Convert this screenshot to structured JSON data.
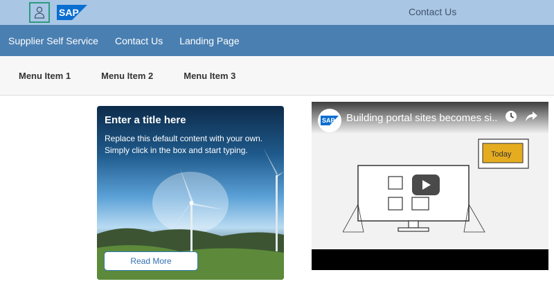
{
  "header": {
    "logo_text": "SAP",
    "contact_label": "Contact Us"
  },
  "nav": {
    "items": [
      {
        "label": "Supplier Self Service"
      },
      {
        "label": "Contact Us"
      },
      {
        "label": "Landing Page"
      }
    ]
  },
  "menu": {
    "items": [
      {
        "label": "Menu Item 1"
      },
      {
        "label": "Menu Item 2"
      },
      {
        "label": "Menu Item 3"
      }
    ]
  },
  "card": {
    "title": "Enter a title here",
    "body": "Replace this default content with your own. Simply click in the box and start typing.",
    "button_label": "Read More"
  },
  "video": {
    "title": "Building portal sites becomes si...",
    "channel_logo_text": "SAP",
    "note_text": "Today"
  },
  "colors": {
    "topbar": "#a9c6e4",
    "navbar": "#4a7fb1",
    "menubar": "#f7f7f7",
    "accent_focus": "#2e9a7e",
    "sap_blue": "#0a6ed1"
  }
}
